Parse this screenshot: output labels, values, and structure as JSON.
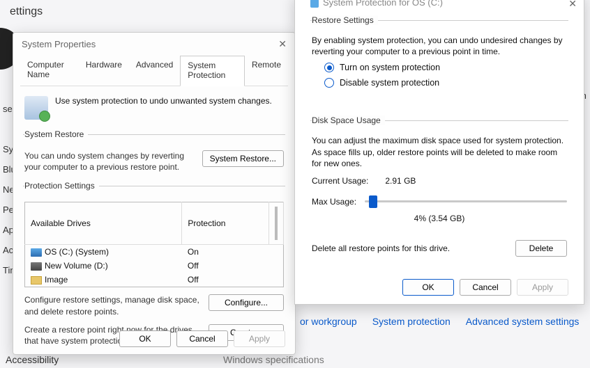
{
  "background": {
    "settings_label": "ettings",
    "snippet_right": "ne th",
    "side_items": [
      "Syst",
      "Blu",
      "Net",
      "Pers",
      "App",
      "Acc",
      "Tim",
      "se"
    ],
    "links": [
      "or workgroup",
      "System protection",
      "Advanced system settings"
    ],
    "accessibility": "Accessibility",
    "winspec": "Windows specifications"
  },
  "sysprop": {
    "title": "System Properties",
    "tabs": [
      "Computer Name",
      "Hardware",
      "Advanced",
      "System Protection",
      "Remote"
    ],
    "intro": "Use system protection to undo unwanted system changes.",
    "restore": {
      "legend": "System Restore",
      "text": "You can undo system changes by reverting your computer to a previous restore point.",
      "button": "System Restore..."
    },
    "protection": {
      "legend": "Protection Settings",
      "col_drive": "Available Drives",
      "col_prot": "Protection",
      "rows": [
        {
          "label": "OS (C:) (System)",
          "status": "On",
          "icon": "drv-c"
        },
        {
          "label": "New Volume (D:)",
          "status": "Off",
          "icon": "drv-d"
        },
        {
          "label": "Image",
          "status": "Off",
          "icon": "drv-img"
        }
      ],
      "configure_text": "Configure restore settings, manage disk space, and delete restore points.",
      "configure_btn": "Configure...",
      "create_text": "Create a restore point right now for the drives that have system protection turned on.",
      "create_btn": "Create..."
    },
    "buttons": {
      "ok": "OK",
      "cancel": "Cancel",
      "apply": "Apply"
    }
  },
  "protdlg": {
    "title": "System Protection for OS (C:)",
    "restore": {
      "legend": "Restore Settings",
      "intro": "By enabling system protection, you can undo undesired changes by reverting your computer to a previous point in time.",
      "opt_on": "Turn on system protection",
      "opt_off": "Disable system protection"
    },
    "disk": {
      "legend": "Disk Space Usage",
      "intro": "You can adjust the maximum disk space used for system protection. As space fills up, older restore points will be deleted to make room for new ones.",
      "current_label": "Current Usage:",
      "current_value": "2.91 GB",
      "max_label": "Max Usage:",
      "slider_percent": 4,
      "slider_display": "4% (3.54 GB)",
      "delete_text": "Delete all restore points for this drive.",
      "delete_btn": "Delete"
    },
    "buttons": {
      "ok": "OK",
      "cancel": "Cancel",
      "apply": "Apply"
    }
  }
}
